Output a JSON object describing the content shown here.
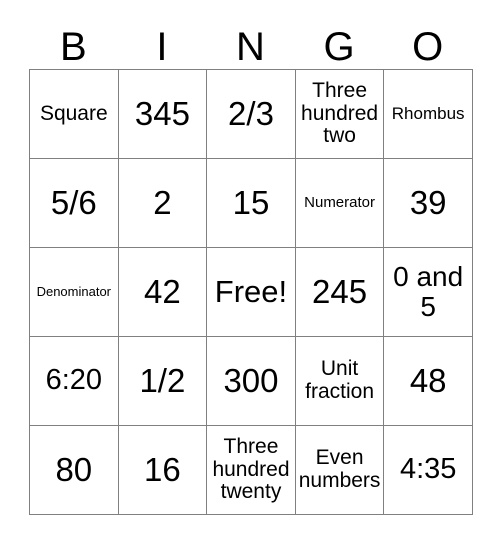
{
  "card": {
    "title_letters": [
      "B",
      "I",
      "N",
      "G",
      "O"
    ],
    "columns": [
      "B",
      "I",
      "N",
      "G",
      "O"
    ],
    "border_color": "#808080",
    "text_color": "#000000",
    "background_color": "#ffffff",
    "rows": [
      [
        {
          "text": "Square",
          "size": "fs-sm"
        },
        {
          "text": "345",
          "size": "fs-xxl"
        },
        {
          "text": "2/3",
          "size": "fs-xxl"
        },
        {
          "text": "Three hundred two",
          "size": "fs-sm"
        },
        {
          "text": "Rhombus",
          "size": "fs-xs"
        }
      ],
      [
        {
          "text": "5/6",
          "size": "fs-xxl"
        },
        {
          "text": "2",
          "size": "fs-xxl"
        },
        {
          "text": "15",
          "size": "fs-xxl"
        },
        {
          "text": "Numerator",
          "size": "fs-xxs"
        },
        {
          "text": "39",
          "size": "fs-xxl"
        }
      ],
      [
        {
          "text": "Denominator",
          "size": "fs-tiny"
        },
        {
          "text": "42",
          "size": "fs-xxl"
        },
        {
          "text": "Free!",
          "size": "fs-xl"
        },
        {
          "text": "245",
          "size": "fs-xxl"
        },
        {
          "text": "0 and 5",
          "size": "fs-md"
        }
      ],
      [
        {
          "text": "6:20",
          "size": "fs-lg"
        },
        {
          "text": "1/2",
          "size": "fs-xxl"
        },
        {
          "text": "300",
          "size": "fs-xxl"
        },
        {
          "text": "Unit fraction",
          "size": "fs-sm"
        },
        {
          "text": "48",
          "size": "fs-xxl"
        }
      ],
      [
        {
          "text": "80",
          "size": "fs-xxl"
        },
        {
          "text": "16",
          "size": "fs-xxl"
        },
        {
          "text": "Three hundred twenty",
          "size": "fs-sm"
        },
        {
          "text": "Even numbers",
          "size": "fs-sm"
        },
        {
          "text": "4:35",
          "size": "fs-lg"
        }
      ]
    ],
    "free_space": {
      "row": 2,
      "col": 2,
      "label": "Free!"
    }
  }
}
